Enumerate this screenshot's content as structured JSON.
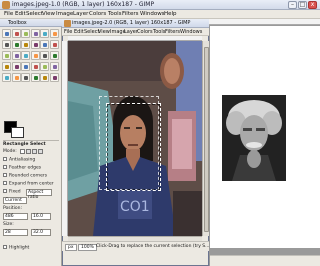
{
  "main_window": {
    "title": "images.jpeg-1.0 (RGB, 1 layer) 160x187 - GIMP",
    "menu": [
      "File",
      "Edit",
      "Select",
      "View",
      "Image",
      "Layer",
      "Colors",
      "Tools",
      "Filters",
      "Windows",
      "Help"
    ],
    "controls": {
      "minimize": "–",
      "maximize": "□",
      "close": "x"
    }
  },
  "toolbox": {
    "title": "Toolbox",
    "options_title": "Rectangle Select",
    "mode_label": "Mode:",
    "options": [
      "Antialiasing",
      "Feather edges",
      "Rounded corners",
      "Expand from center"
    ],
    "fixed_label": "Fixed",
    "fixed_value": "Aspect ratio",
    "current_label": "Current",
    "position_label": "Position:",
    "position_x": "486",
    "position_y": "16.0",
    "size_label": "Size:",
    "size_w": "28",
    "size_h": "32.0",
    "highlight_label": "Highlight",
    "unit": "px",
    "icons": [
      "rect-select-icon",
      "ellipse-select-icon",
      "lasso-icon",
      "wand-icon",
      "color-select-icon",
      "scissors-icon",
      "paths-icon",
      "color-picker-icon",
      "zoom-icon",
      "measure-icon",
      "move-icon",
      "align-icon",
      "crop-icon",
      "rotate-icon",
      "scale-icon",
      "shear-icon",
      "perspective-icon",
      "flip-icon",
      "text-icon",
      "bucket-fill-icon",
      "blend-icon",
      "pencil-icon",
      "paintbrush-icon",
      "eraser-icon",
      "airbrush-icon",
      "ink-icon",
      "clone-icon",
      "heal-icon",
      "smudge-icon",
      "dodge-icon"
    ]
  },
  "image_window": {
    "title": "images.jpeg-2.0 (RGB, 1 layer) 160x187 - GIMP",
    "menu": [
      "File",
      "Edit",
      "Select",
      "View",
      "Image",
      "Layer",
      "Colors",
      "Tools",
      "Filters",
      "Windows",
      "Help"
    ],
    "status": {
      "unit": "px",
      "zoom": "100%",
      "message": "Click-Drag to replace the current selection (try S..."
    }
  },
  "colors": {
    "title_bar": "#d3dbea",
    "window_bg": "#ece9e2",
    "canvas_bg": "#9a9a9a",
    "selection": "#ffffff"
  }
}
